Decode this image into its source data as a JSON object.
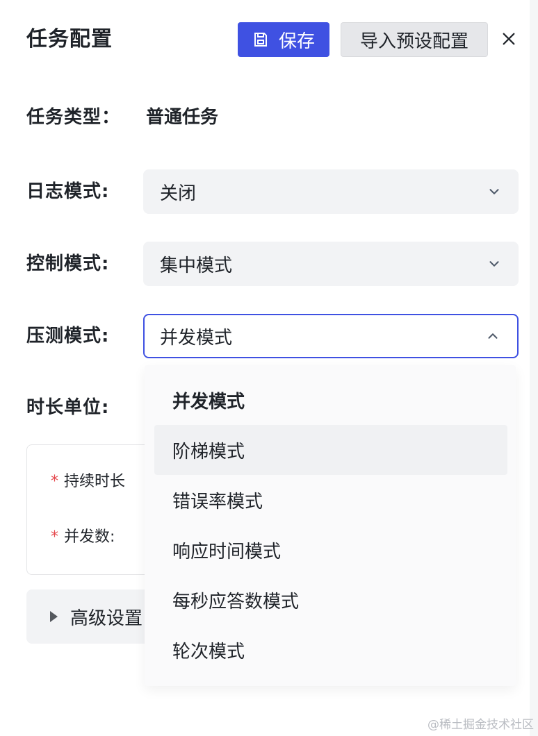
{
  "header": {
    "title": "任务配置",
    "save_label": "保存",
    "import_label": "导入预设配置"
  },
  "form": {
    "task_type": {
      "label": "任务类型：",
      "value": "普通任务"
    },
    "log_mode": {
      "label": "日志模式:",
      "value": "关闭"
    },
    "control_mode": {
      "label": "控制模式:",
      "value": "集中模式"
    },
    "stress_mode": {
      "label": "压测模式:",
      "value": "并发模式",
      "options": [
        "并发模式",
        "阶梯模式",
        "错误率模式",
        "响应时间模式",
        "每秒应答数模式",
        "轮次模式"
      ]
    },
    "duration_unit": {
      "label": "时长单位:"
    }
  },
  "card": {
    "duration_label": "持续时长",
    "concurrency_label": "并发数:",
    "required_mark": "*"
  },
  "advanced": {
    "label": "高级设置"
  },
  "watermark": "@稀土掘金技术社区",
  "colors": {
    "primary": "#3f51e2",
    "required": "#e5484d",
    "select_bg": "#f2f3f5"
  }
}
